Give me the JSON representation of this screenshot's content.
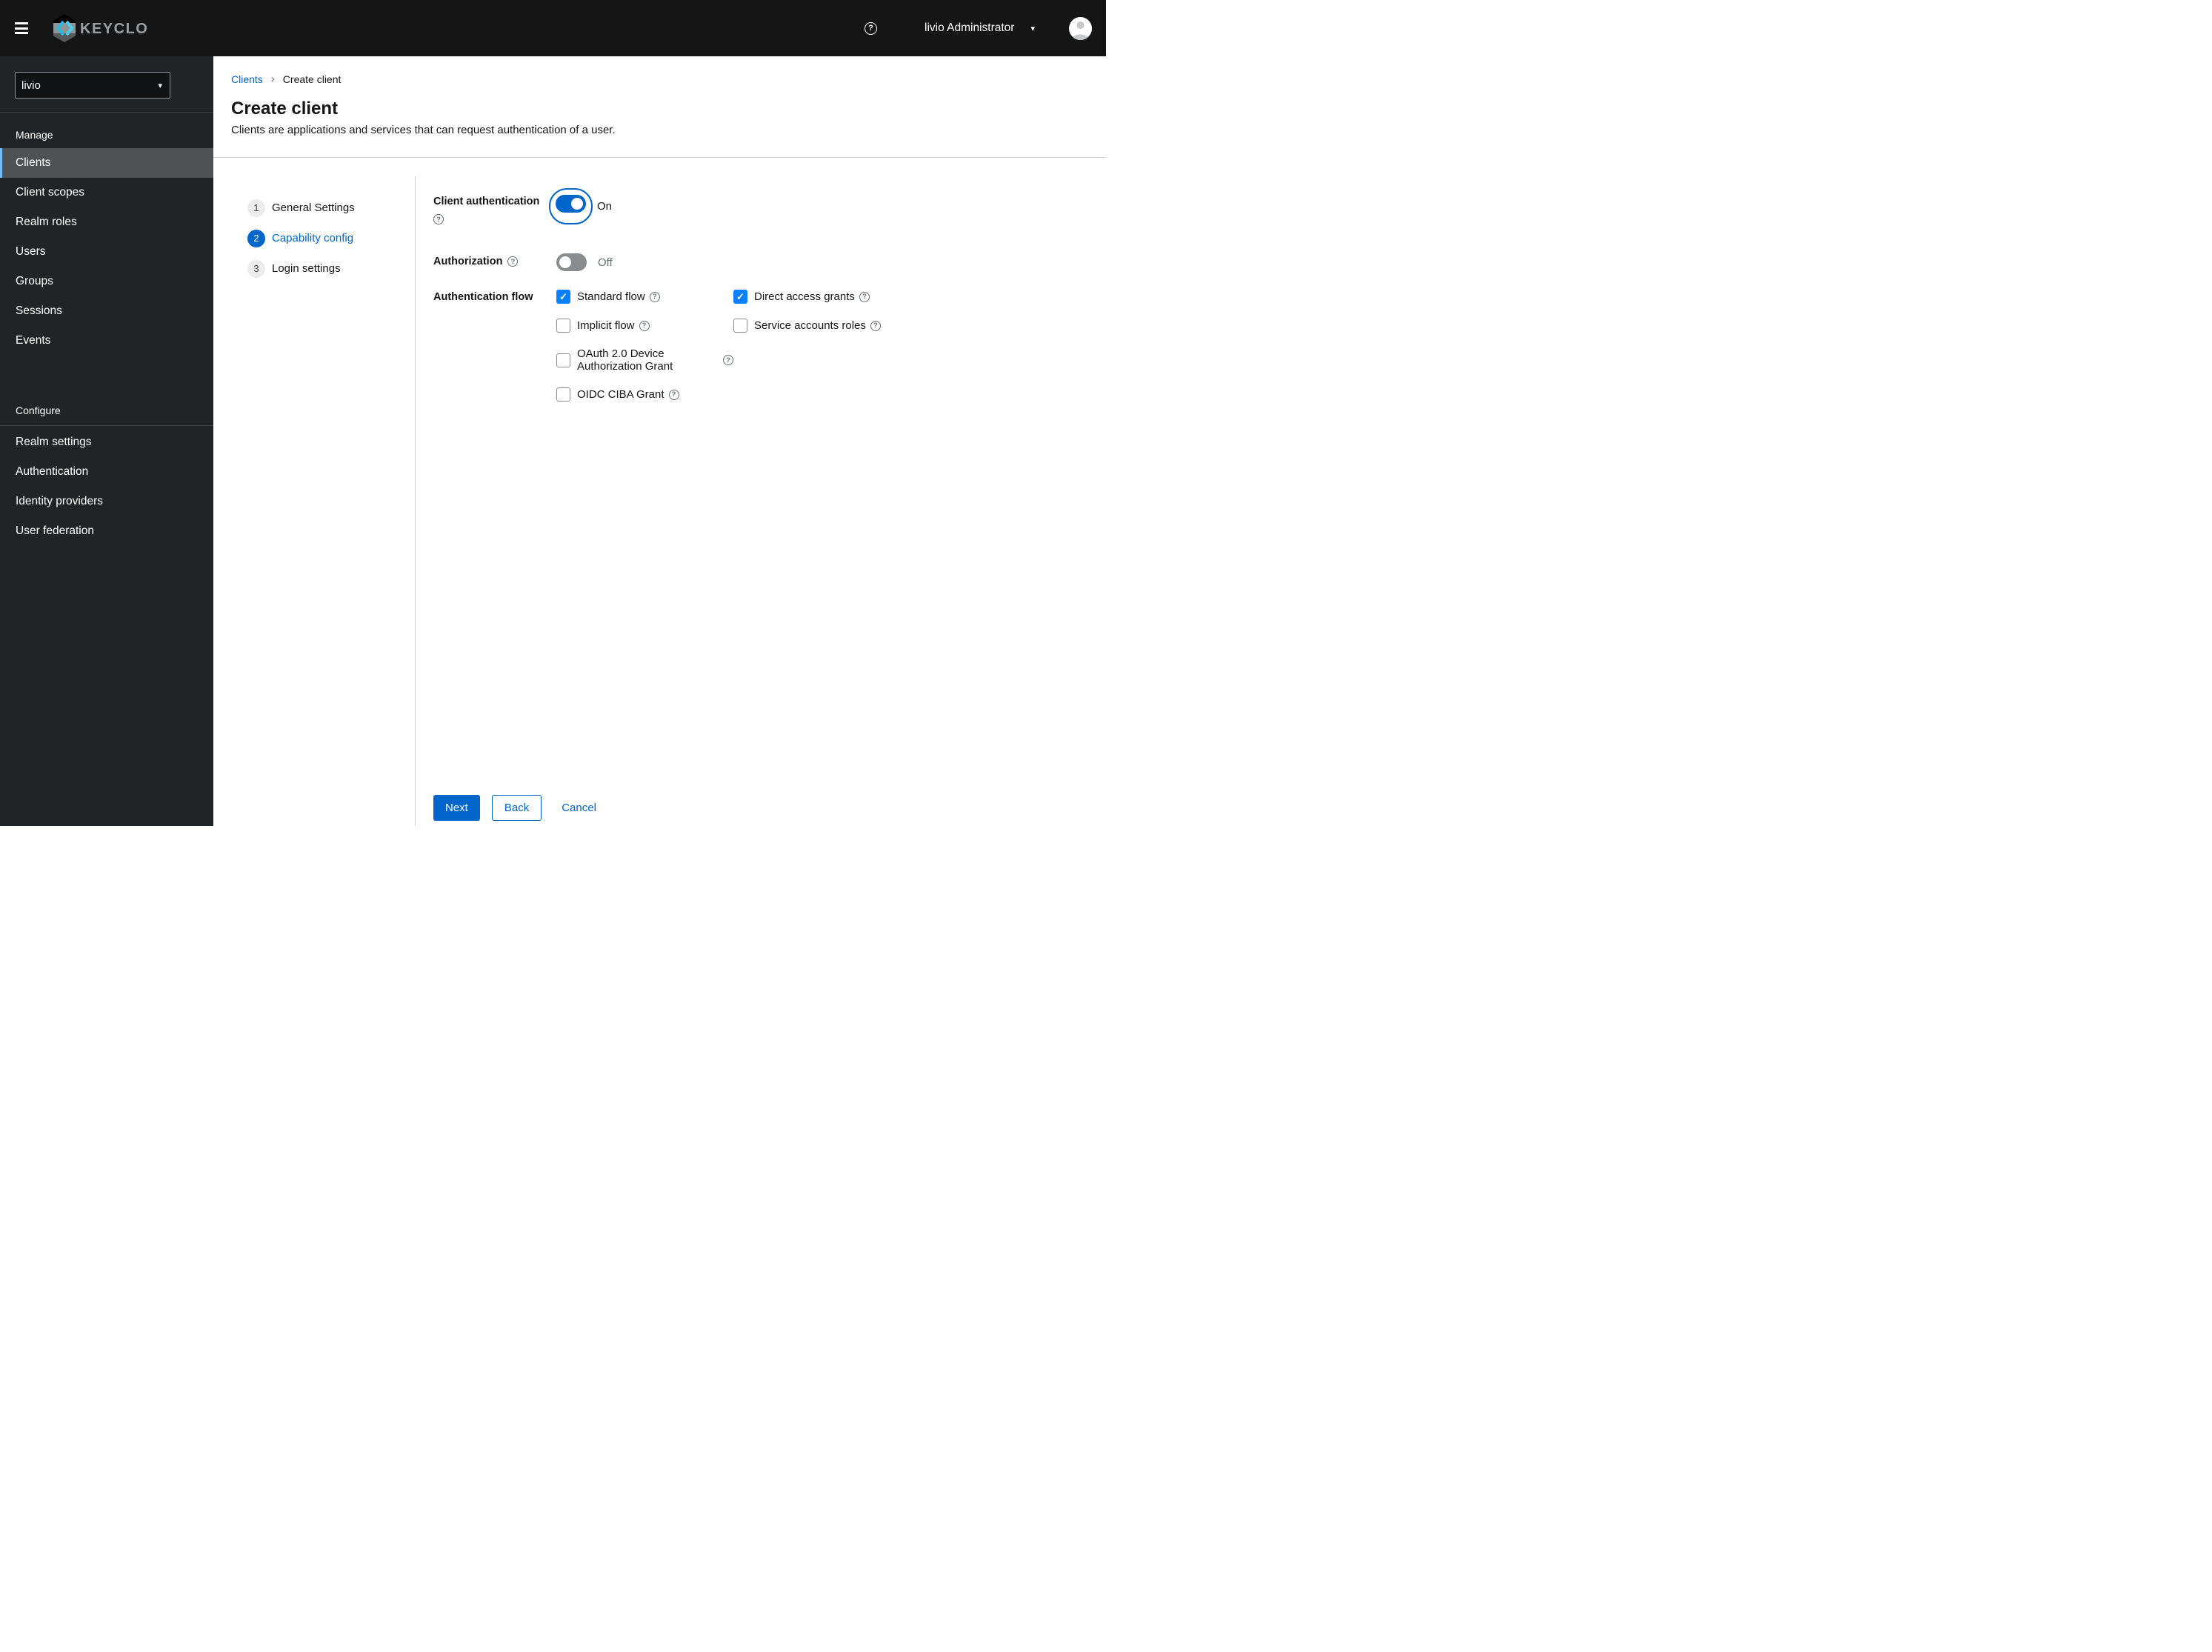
{
  "icons": {
    "question": "?",
    "caret_down": "▾",
    "breadcrumb_separator": "›",
    "check": "✓"
  },
  "colors": {
    "primary_blue": "#0066cc",
    "checkbox_blue": "#0b80ff",
    "masthead_bg": "#151515",
    "sidebar_bg": "#212427",
    "sidebar_selected_bg": "#4f5255",
    "sidebar_selected_accent": "#73bcf7",
    "divider": "#d2d2d2",
    "muted_text": "#6a6e73"
  },
  "header": {
    "brand": "KEYCLOAK",
    "user": "livio Administrator"
  },
  "sidebar": {
    "realm_selector": {
      "value": "livio"
    },
    "groups": [
      {
        "label": "Manage",
        "items": [
          {
            "label": "Clients",
            "selected": true
          },
          {
            "label": "Client scopes",
            "selected": false
          },
          {
            "label": "Realm roles",
            "selected": false
          },
          {
            "label": "Users",
            "selected": false
          },
          {
            "label": "Groups",
            "selected": false
          },
          {
            "label": "Sessions",
            "selected": false
          },
          {
            "label": "Events",
            "selected": false
          }
        ]
      },
      {
        "label": "Configure",
        "items": [
          {
            "label": "Realm settings",
            "selected": false
          },
          {
            "label": "Authentication",
            "selected": false
          },
          {
            "label": "Identity providers",
            "selected": false
          },
          {
            "label": "User federation",
            "selected": false
          }
        ]
      }
    ]
  },
  "breadcrumb": {
    "link": "Clients",
    "current": "Create client"
  },
  "page": {
    "title": "Create client",
    "subtitle": "Clients are applications and services that can request authentication of a user."
  },
  "wizard": {
    "steps": [
      {
        "number": "1",
        "label": "General Settings",
        "active": false
      },
      {
        "number": "2",
        "label": "Capability config",
        "active": true
      },
      {
        "number": "3",
        "label": "Login settings",
        "active": false
      }
    ]
  },
  "form": {
    "client_authentication": {
      "label": "Client authentication",
      "state": "On",
      "enabled": true
    },
    "authorization": {
      "label": "Authorization",
      "state": "Off",
      "enabled": false
    },
    "authentication_flow": {
      "label": "Authentication flow",
      "options": [
        {
          "label": "Standard flow",
          "checked": true
        },
        {
          "label": "Direct access grants",
          "checked": true
        },
        {
          "label": "Implicit flow",
          "checked": false
        },
        {
          "label": "Service accounts roles",
          "checked": false
        },
        {
          "label": "OAuth 2.0 Device Authorization Grant",
          "checked": false
        },
        {
          "label": "OIDC CIBA Grant",
          "checked": false
        }
      ]
    }
  },
  "footer": {
    "next": "Next",
    "back": "Back",
    "cancel": "Cancel"
  }
}
